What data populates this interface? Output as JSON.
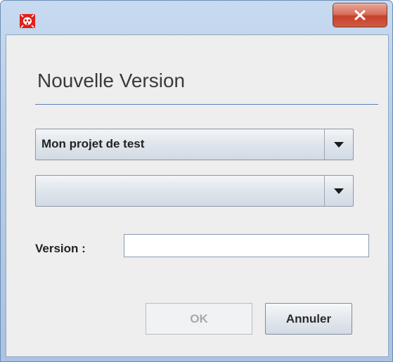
{
  "window": {
    "close_symbol": "x",
    "app_icon": "red-bug-logo-icon"
  },
  "dialog": {
    "title": "Nouvelle Version"
  },
  "project_select": {
    "selected": "Mon projet de test"
  },
  "second_select": {
    "selected": ""
  },
  "version_field": {
    "label": "Version :",
    "value": "",
    "placeholder": ""
  },
  "buttons": {
    "ok_label": "OK",
    "ok_enabled": false,
    "cancel_label": "Annuler"
  },
  "colors": {
    "window_frame": "#b7cde8",
    "close_button": "#c6412a",
    "title_rule": "#5b7fb8",
    "dialog_bg": "#eeeeee"
  }
}
